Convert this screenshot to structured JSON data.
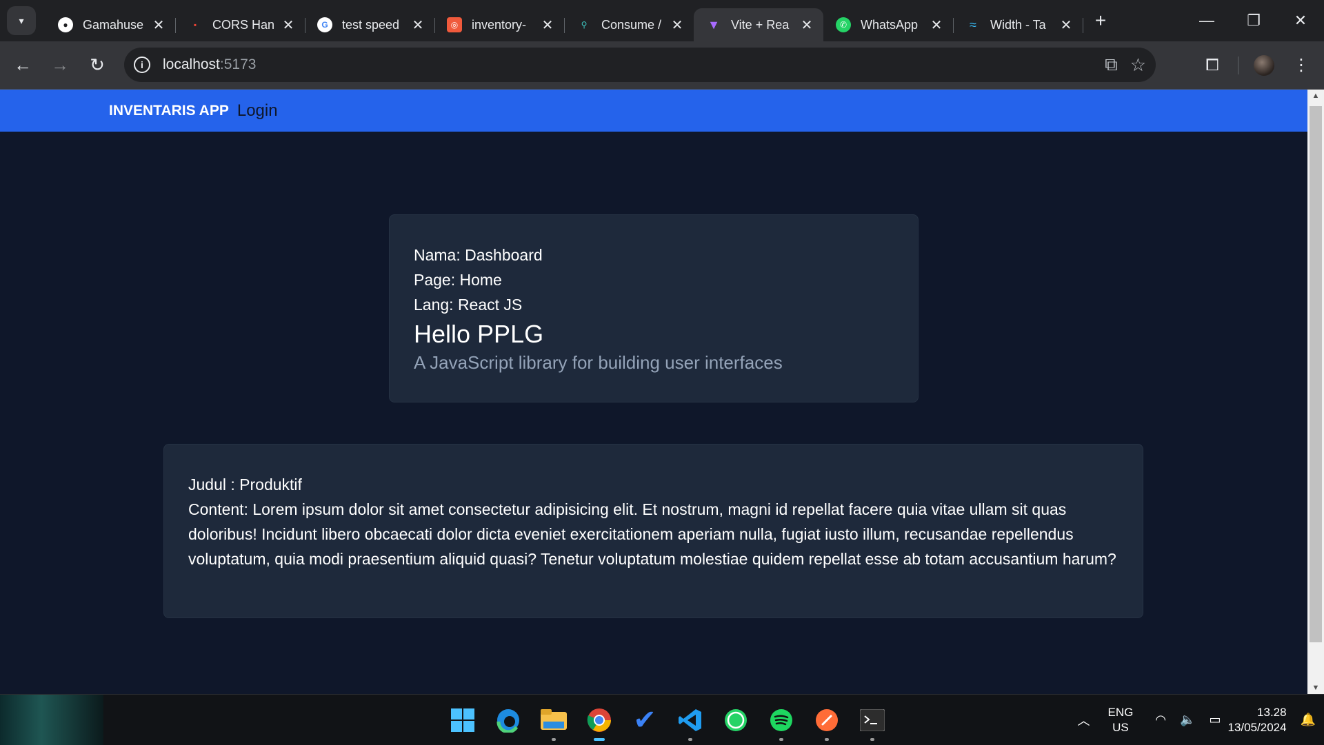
{
  "browser": {
    "tabs": [
      {
        "title": "Gamahuse",
        "icon": "github-icon",
        "active": false
      },
      {
        "title": "CORS Han",
        "icon": "page-icon",
        "active": false
      },
      {
        "title": "test speed",
        "icon": "google-icon",
        "active": false
      },
      {
        "title": "inventory-",
        "icon": "app-icon",
        "active": false
      },
      {
        "title": "Consume /",
        "icon": "api-icon",
        "active": false
      },
      {
        "title": "Vite + Rea",
        "icon": "vite-icon",
        "active": true
      },
      {
        "title": "WhatsApp",
        "icon": "whatsapp-icon",
        "active": false
      },
      {
        "title": "Width - Ta",
        "icon": "tailwind-icon",
        "active": false
      }
    ],
    "url_host": "localhost",
    "url_port": ":5173"
  },
  "app": {
    "brand": "INVENTARIS APP",
    "nav_link": "Login",
    "colors": {
      "navbar": "#2563eb",
      "background": "#0f172a",
      "card": "#1e293b"
    }
  },
  "card1": {
    "nama": "Nama: Dashboard",
    "page": "Page: Home",
    "lang": "Lang: React JS",
    "heading": "Hello PPLG",
    "description": "A JavaScript library for building user interfaces"
  },
  "card2": {
    "judul": "Judul : Produktif",
    "content": "Content: Lorem ipsum dolor sit amet consectetur adipisicing elit. Et nostrum, magni id repellat facere quia vitae ullam sit quas doloribus! Incidunt libero obcaecati dolor dicta eveniet exercitationem aperiam nulla, fugiat iusto illum, recusandae repellendus voluptatum, quia modi praesentium aliquid quasi? Tenetur voluptatum molestiae quidem repellat esse ab totam accusantium harum?"
  },
  "taskbar": {
    "language": "ENG",
    "region": "US",
    "time": "13.28",
    "date": "13/05/2024"
  }
}
